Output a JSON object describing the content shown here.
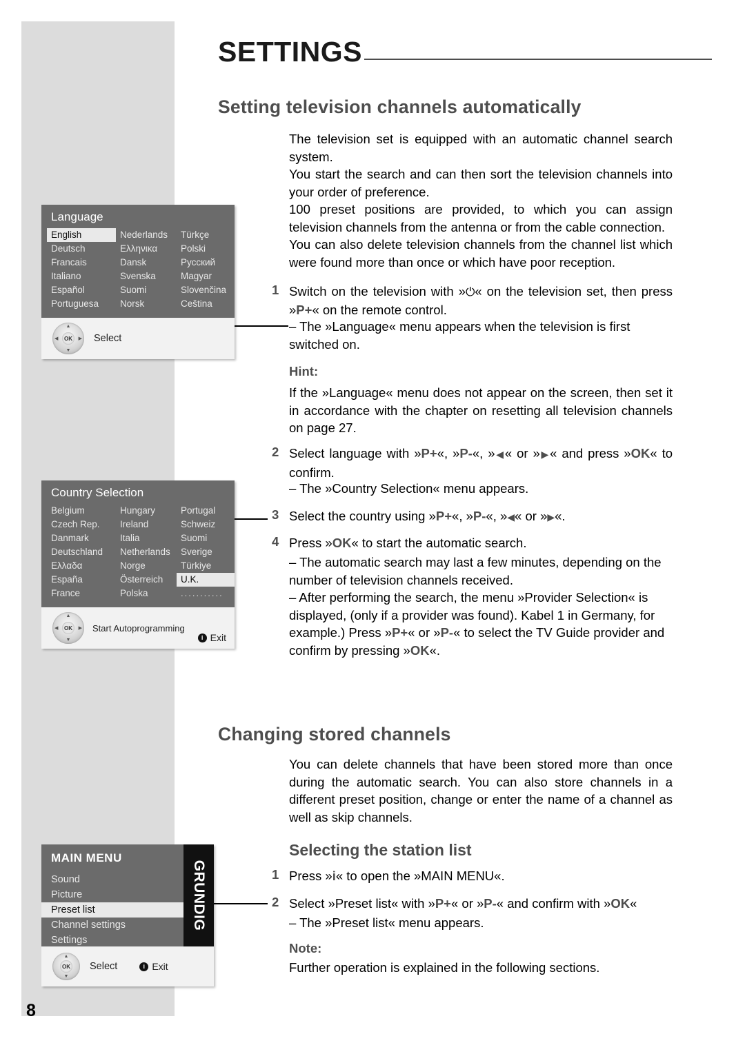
{
  "page": {
    "number": "8",
    "header_title": "SETTINGS"
  },
  "sections": {
    "auto_title": "Setting television channels automatically",
    "changing_title": "Changing stored channels",
    "station_list_title": "Selecting the station list"
  },
  "auto": {
    "p1": "The television set is equipped with an automatic channel search system.",
    "p2": "You start the search and can then sort the television channels into your order of preference.",
    "p3": "100 preset positions are provided, to which you can assign television channels from the antenna or from the cable connection.",
    "p4": "You can also delete television channels from the channel list which were found more than once or which have poor reception.",
    "step1_num": "1",
    "step1_a": "Switch on the television with »",
    "step1_b": "« on the television set, then press »",
    "step1_key": "P+",
    "step1_c": "« on the remote control.",
    "step1_dash": "– The »Language« menu appears when the television is first switched on.",
    "hint_label": "Hint:",
    "hint_text": "If the »Language« menu does not appear on the screen, then set it in accordance with the chapter on resetting all television channels on page 27.",
    "step2_num": "2",
    "step2_text_a": "Select language with »",
    "step2_k1": "P+",
    "step2_text_b": "«, »",
    "step2_k2": "P-",
    "step2_text_c": "«, »",
    "step2_text_d": "« or »",
    "step2_text_e": "« and press »",
    "step2_k3": "OK",
    "step2_text_f": "« to confirm.",
    "step2_dash": "– The »Country Selection« menu appears.",
    "step3_num": "3",
    "step3_text_a": "Select the country using »",
    "step3_k1": "P+",
    "step3_text_b": "«, »",
    "step3_k2": "P-",
    "step3_text_c": "«, »",
    "step3_text_d": "« or »",
    "step3_text_e": "«.",
    "step4_num": "4",
    "step4_text_a": "Press »",
    "step4_k1": "OK",
    "step4_text_b": "« to start the automatic search.",
    "step4_dash1": "– The automatic search may last a few minutes, depending on the number of television channels received.",
    "step4_dash2_a": "– After performing the search, the menu »Provider Selection« is displayed, (only if a provider was found). Kabel 1 in Germany, for example.) Press »",
    "step4_dash2_k1": "P+",
    "step4_dash2_b": "« or »",
    "step4_dash2_k2": "P-",
    "step4_dash2_c": "« to select the TV Guide provider and confirm by pressing »",
    "step4_dash2_k3": "OK",
    "step4_dash2_d": "«."
  },
  "changing": {
    "p1": "You can delete channels that have been stored more than once during the automatic search. You can also store channels in a different preset position, change or enter the name of a channel as well as skip channels.",
    "step1_num": "1",
    "step1_text": "Press »i« to open the »MAIN MENU«.",
    "step1_key": "i",
    "step1_pre": "Press »",
    "step1_post": "« to open the »MAIN MENU«.",
    "step2_num": "2",
    "step2_a": "Select »Preset list« with »",
    "step2_k1": "P+",
    "step2_b": "« or »",
    "step2_k2": "P-",
    "step2_c": "« and confirm with »",
    "step2_k3": "OK",
    "step2_d": "«",
    "step2_dash": "– The »Preset list« menu appears.",
    "note_label": "Note:",
    "note_text": "Further operation is explained in the following sections."
  },
  "osd_language": {
    "title": "Language",
    "col1": [
      "English",
      "Deutsch",
      "Francais",
      "Italiano",
      "Español",
      "Portuguesa"
    ],
    "col2": [
      "Nederlands",
      "Ελληνικα",
      "Dansk",
      "Svenska",
      "Suomi",
      "Norsk"
    ],
    "col3": [
      "Türkçe",
      "Polski",
      "Русский",
      "Magyar",
      "Slovenčina",
      "Ceština"
    ],
    "selected": "English",
    "button_label": "Select"
  },
  "osd_country": {
    "title": "Country Selection",
    "col1": [
      "Belgium",
      "Czech Rep.",
      "Danmark",
      "Deutschland",
      "Ελλαδα",
      "España",
      "France"
    ],
    "col2": [
      "Hungary",
      "Ireland",
      "Italia",
      "Netherlands",
      "Norge",
      "Österreich",
      "Polska"
    ],
    "col3": [
      "Portugal",
      "Schweiz",
      "Suomi",
      "Sverige",
      "Türkiye",
      "U.K.",
      "..........."
    ],
    "selected": "U.K.",
    "button_label": "Start Autoprogramming",
    "exit_label": "Exit",
    "exit_icon": "i"
  },
  "osd_mainmenu": {
    "title": "MAIN MENU",
    "items": [
      "Sound",
      "Picture",
      "Preset list",
      "Channel settings",
      "Settings"
    ],
    "selected": "Preset list",
    "brand": "GRUNDIG",
    "button_label": "Select",
    "exit_label": "Exit",
    "exit_icon": "i"
  }
}
